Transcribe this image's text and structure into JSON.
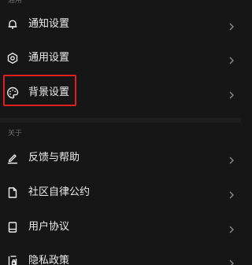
{
  "section_general": {
    "label": "通用"
  },
  "section_about": {
    "label": "关于"
  },
  "general_items": [
    {
      "label": "通知设置",
      "icon": "bell-icon"
    },
    {
      "label": "通用设置",
      "icon": "gear-icon"
    },
    {
      "label": "背景设置",
      "icon": "palette-icon"
    }
  ],
  "about_items": [
    {
      "label": "反馈与帮助",
      "icon": "pen-icon"
    },
    {
      "label": "社区自律公约",
      "icon": "document-icon"
    },
    {
      "label": "用户协议",
      "icon": "agreement-icon"
    },
    {
      "label": "隐私政策",
      "icon": "privacy-icon"
    }
  ],
  "colors": {
    "background": "#161616",
    "text": "#ececec",
    "muted": "#6e6e6e",
    "highlight": "#e02020"
  }
}
